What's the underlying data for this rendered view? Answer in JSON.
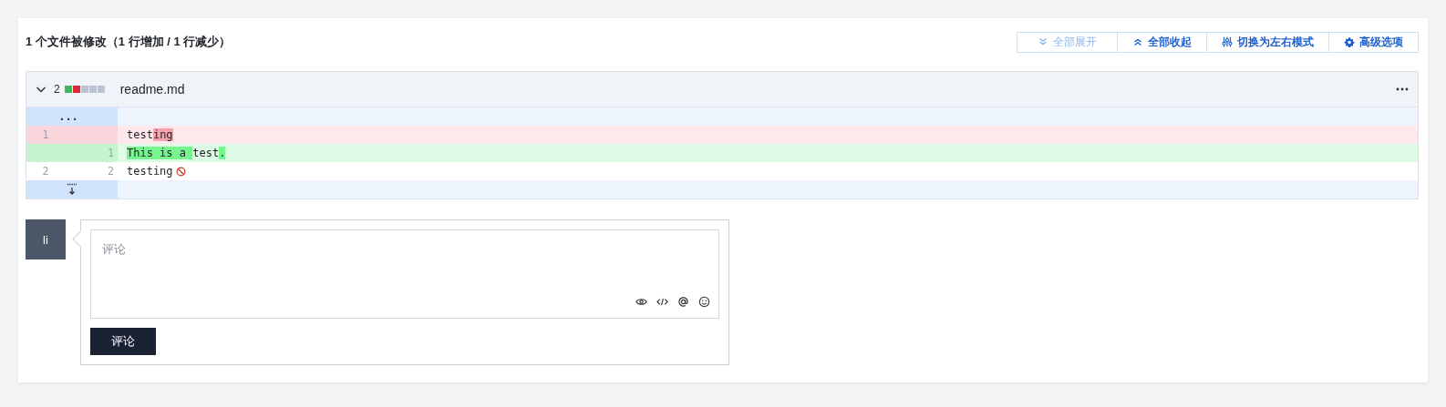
{
  "summary": "1 个文件被修改（1 行增加 / 1 行减少）",
  "toolbar": [
    {
      "label": "全部展开",
      "disabled": true
    },
    {
      "label": "全部收起",
      "disabled": false
    },
    {
      "label": "切换为左右模式",
      "disabled": false
    },
    {
      "label": "高级选项",
      "disabled": false
    }
  ],
  "file": {
    "expanded": true,
    "changes": "2",
    "stats": [
      {
        "color": "#3cb55e"
      },
      {
        "color": "#e0283c"
      },
      {
        "color": "#bcc3d1"
      },
      {
        "color": "#bcc3d1"
      },
      {
        "color": "#bcc3d1"
      }
    ],
    "name": "readme.md",
    "lines": [
      {
        "kind": "expand-up",
        "marker": "..."
      },
      {
        "kind": "removed",
        "old": "1",
        "segments": [
          {
            "text": "test",
            "highlight": false
          },
          {
            "text": "ing",
            "highlight": true
          }
        ]
      },
      {
        "kind": "added",
        "new": "1",
        "segments": [
          {
            "text": "This is a ",
            "highlight": true
          },
          {
            "text": "test",
            "highlight": false
          },
          {
            "text": ".",
            "highlight": true
          }
        ]
      },
      {
        "kind": "context",
        "old": "2",
        "new": "2",
        "segments": [
          {
            "text": "testing",
            "highlight": false
          }
        ],
        "no_newline": true
      },
      {
        "kind": "expand-down"
      }
    ]
  },
  "comment": {
    "avatar": "li",
    "placeholder": "评论",
    "submit": "评论"
  }
}
